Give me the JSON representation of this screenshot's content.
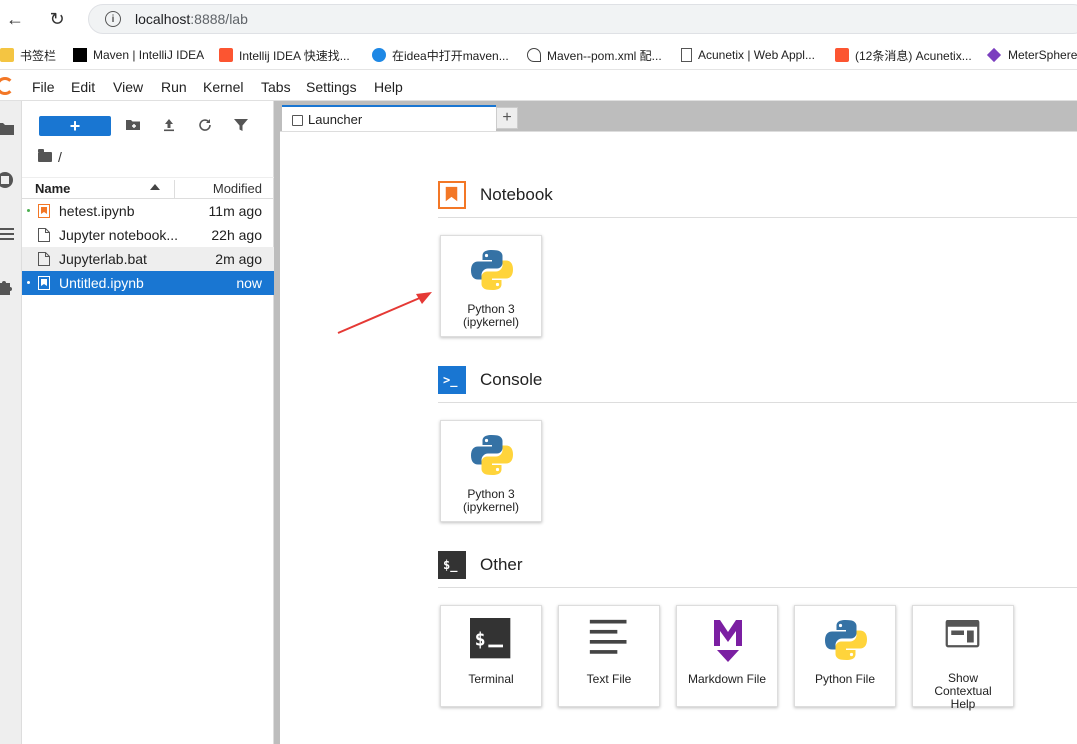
{
  "browser": {
    "url_host": "localhost",
    "url_rest": ":8888/lab"
  },
  "bookmarks": [
    {
      "label": "书签栏"
    },
    {
      "label": "Maven | IntelliJ IDEA"
    },
    {
      "label": "Intellij IDEA 快速找..."
    },
    {
      "label": "在idea中打开maven..."
    },
    {
      "label": "Maven--pom.xml 配..."
    },
    {
      "label": "Acunetix | Web Appl..."
    },
    {
      "label": "(12条消息) Acunetix..."
    },
    {
      "label": "MeterSphere"
    }
  ],
  "menu": [
    "File",
    "Edit",
    "View",
    "Run",
    "Kernel",
    "Tabs",
    "Settings",
    "Help"
  ],
  "filebrowser": {
    "new_label": "+",
    "breadcrumb": "/",
    "col_name": "Name",
    "col_modified": "Modified",
    "files": [
      {
        "name": "hetest.ipynb",
        "modified": "11m ago",
        "type": "notebook",
        "running": true
      },
      {
        "name": "Jupyter notebook...",
        "modified": "22h ago",
        "type": "file",
        "running": false
      },
      {
        "name": "Jupyterlab.bat",
        "modified": "2m ago",
        "type": "file",
        "running": false
      },
      {
        "name": "Untitled.ipynb",
        "modified": "now",
        "type": "notebook",
        "running": true,
        "selected": true
      }
    ]
  },
  "tabs": [
    {
      "label": "Launcher"
    }
  ],
  "add_tab": "+",
  "launcher": {
    "sections": [
      {
        "title": "Notebook",
        "cards": [
          {
            "label_line1": "Python 3",
            "label_line2": "(ipykernel)"
          }
        ]
      },
      {
        "title": "Console",
        "cards": [
          {
            "label_line1": "Python 3",
            "label_line2": "(ipykernel)"
          }
        ]
      },
      {
        "title": "Other",
        "cards": [
          {
            "label": "Terminal"
          },
          {
            "label": "Text File"
          },
          {
            "label": "Markdown File"
          },
          {
            "label": "Python File"
          },
          {
            "label_line1": "Show",
            "label_line2": "Contextual",
            "label_line3": "Help"
          }
        ]
      }
    ],
    "console_icon_text": ">_",
    "other_icon_text": "$_"
  },
  "colors": {
    "accent": "#1976d2",
    "jupyter_orange": "#f37726",
    "annotation_arrow": "#e53935"
  }
}
